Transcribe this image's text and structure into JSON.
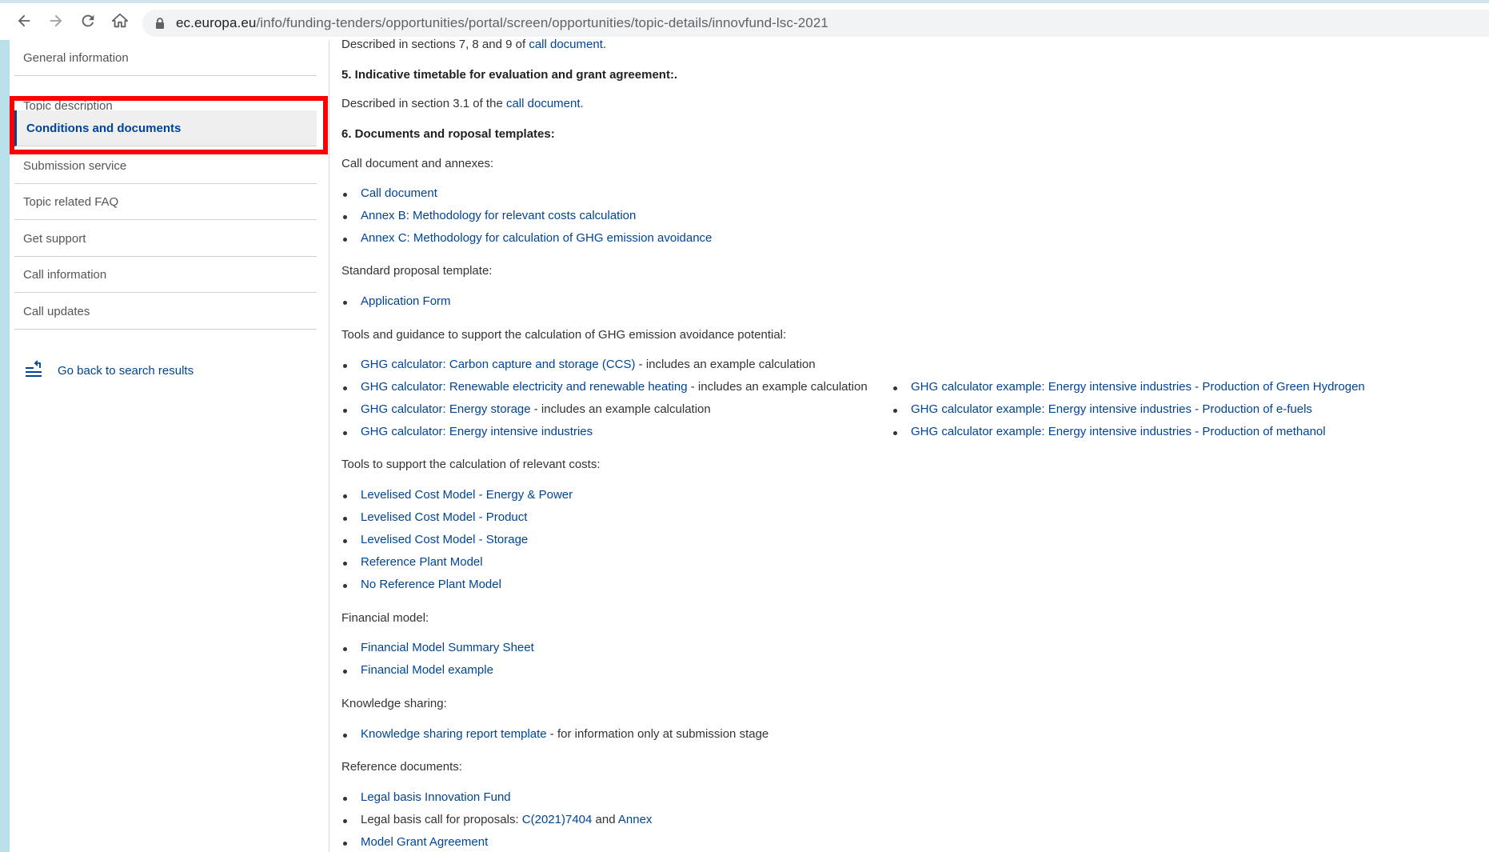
{
  "browser": {
    "url_host": "ec.europa.eu",
    "url_path": "/info/funding-tenders/opportunities/portal/screen/opportunities/topic-details/innovfund-lsc-2021"
  },
  "sidebar": {
    "items": [
      {
        "label": "General information"
      },
      {
        "label": "Topic description"
      },
      {
        "label": "Conditions and documents"
      },
      {
        "label": "Submission service"
      },
      {
        "label": "Topic related FAQ"
      },
      {
        "label": "Get support"
      },
      {
        "label": "Call information"
      },
      {
        "label": "Call updates"
      }
    ],
    "back_link": "Go back to search results"
  },
  "content": {
    "line_described_789_prefix": "Described in sections 7, 8 and 9 of ",
    "call_document_link": "call document",
    "period": ".",
    "heading_5": "5. Indicative timetable for evaluation and grant agreement:.",
    "line_described_31_prefix": "Described in section 3.1 of the ",
    "heading_6": "6. Documents and roposal templates:",
    "call_doc_annexes_label": "Call document and annexes:",
    "call_doc_items": [
      "Call document",
      "Annex B: Methodology for relevant costs calculation",
      "Annex C: Methodology for calculation of GHG emission avoidance"
    ],
    "standard_template_label": "Standard proposal template:",
    "application_form": "Application Form",
    "ghg_tools_label": "Tools and guidance to support the calculation of GHG emission avoidance potential:",
    "ghg_left": [
      {
        "link": "GHG calculator: Carbon capture and storage (CCS)",
        "suffix": " - includes an example calculation"
      },
      {
        "link": "GHG calculator: Renewable electricity and renewable heating",
        "suffix": " - includes an example calculation"
      },
      {
        "link": "GHG calculator: Energy storage",
        "suffix": " - includes an example calculation"
      },
      {
        "link": "GHG calculator: Energy intensive industries",
        "suffix": ""
      }
    ],
    "ghg_right": [
      "GHG calculator example: Energy intensive industries - Production of Green Hydrogen",
      "GHG calculator example: Energy intensive industries - Production of e-fuels",
      "GHG calculator example: Energy intensive industries - Production of methanol"
    ],
    "costs_tools_label": "Tools to support the calculation of relevant costs:",
    "costs_items": [
      "Levelised Cost Model - Energy & Power",
      "Levelised Cost Model - Product",
      "Levelised Cost Model - Storage",
      "Reference Plant Model",
      "No Reference Plant Model"
    ],
    "financial_label": "Financial model:",
    "financial_items": [
      "Financial Model Summary Sheet",
      "Financial Model example"
    ],
    "knowledge_label": "Knowledge sharing:",
    "knowledge_link": "Knowledge sharing report template",
    "knowledge_suffix": " - for information only at submission stage",
    "reference_label": "Reference documents:",
    "ref_legal_basis": "Legal basis Innovation Fund",
    "ref_call_prefix": "Legal basis call for proposals: ",
    "ref_call_link": "C(2021)7404",
    "ref_and": " and ",
    "ref_annex": "Annex",
    "ref_mga": "Model Grant Agreement"
  },
  "colors": {
    "link": "#004494",
    "highlight": "#ff0000"
  }
}
